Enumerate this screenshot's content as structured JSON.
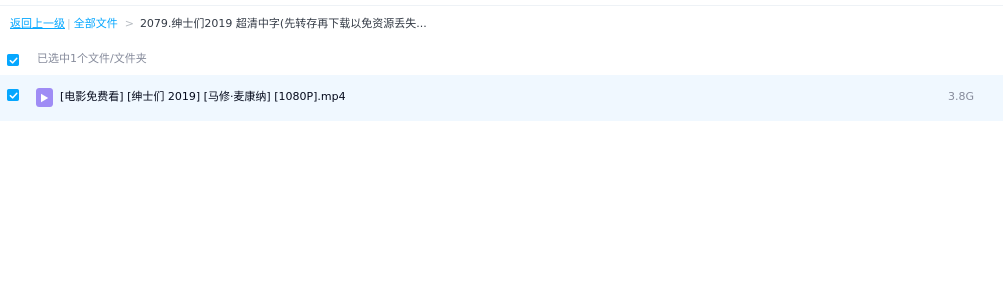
{
  "breadcrumb": {
    "back": "返回上一级",
    "separator": "|",
    "all_files": "全部文件",
    "chevron": ">",
    "current_folder": "2079.绅士们2019 超清中字(先转存再下载以免资源丢失..."
  },
  "selection": {
    "checked": true,
    "summary": "已选中1个文件/文件夹"
  },
  "files": [
    {
      "checked": true,
      "icon": "video-file-icon",
      "name": "[电影免费看] [绅士们 2019] [马修·麦康纳] [1080P].mp4",
      "size": "3.8G"
    }
  ],
  "colors": {
    "accent": "#06a7ff",
    "selected_row_bg": "#f0f8ff",
    "video_icon_bg": "#9f8cf5"
  }
}
